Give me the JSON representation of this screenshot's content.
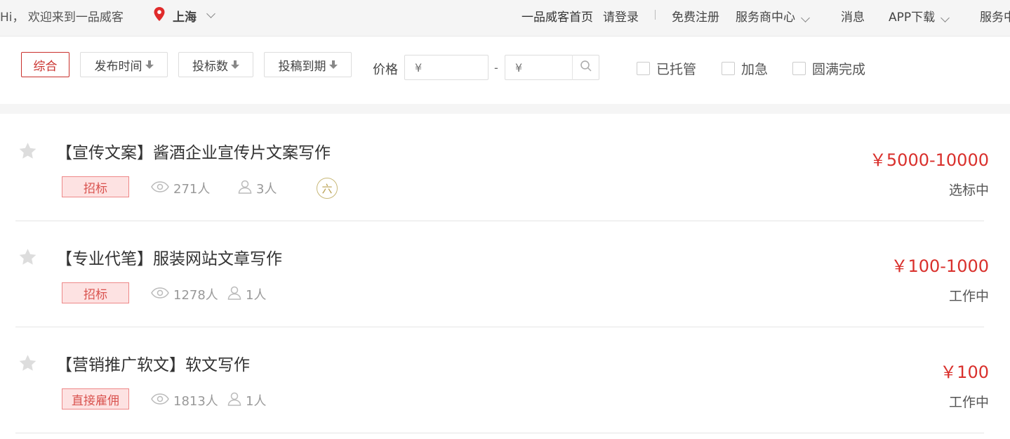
{
  "topbar": {
    "greeting": "Hi， 欢迎来到一品威客",
    "city": "上海",
    "home": "一品威客首页",
    "login": "请登录",
    "register": "免费注册",
    "provider_center": "服务商中心",
    "messages": "消息",
    "app_download": "APP下载",
    "service_cut": "服务中"
  },
  "filters": {
    "sort_all": "综合",
    "sort_time": "发布时间",
    "sort_bids": "投标数",
    "sort_deadline": "投稿到期",
    "price_label": "价格",
    "price_min_placeholder": "¥",
    "price_max_placeholder": "¥",
    "dash": "-",
    "escrowed": "已托管",
    "urgent": "加急",
    "completed": "圆满完成"
  },
  "tasks": [
    {
      "title": "【宣传文案】酱酒企业宣传片文案写作",
      "tag": "招标",
      "views": "271人",
      "bids": "3人",
      "badge": "六",
      "price": "￥5000-10000",
      "status": "选标中"
    },
    {
      "title": "【专业代笔】服装网站文章写作",
      "tag": "招标",
      "views": "1278人",
      "bids": "1人",
      "price": "￥100-1000",
      "status": "工作中"
    },
    {
      "title": "【营销推广软文】软文写作",
      "tag": "直接雇佣",
      "views": "1813人",
      "bids": "1人",
      "price": "￥100",
      "status": "工作中"
    }
  ],
  "colors": {
    "accent": "#d9302c",
    "tag_bg": "#fde2e2",
    "badge": "#b8a050"
  }
}
